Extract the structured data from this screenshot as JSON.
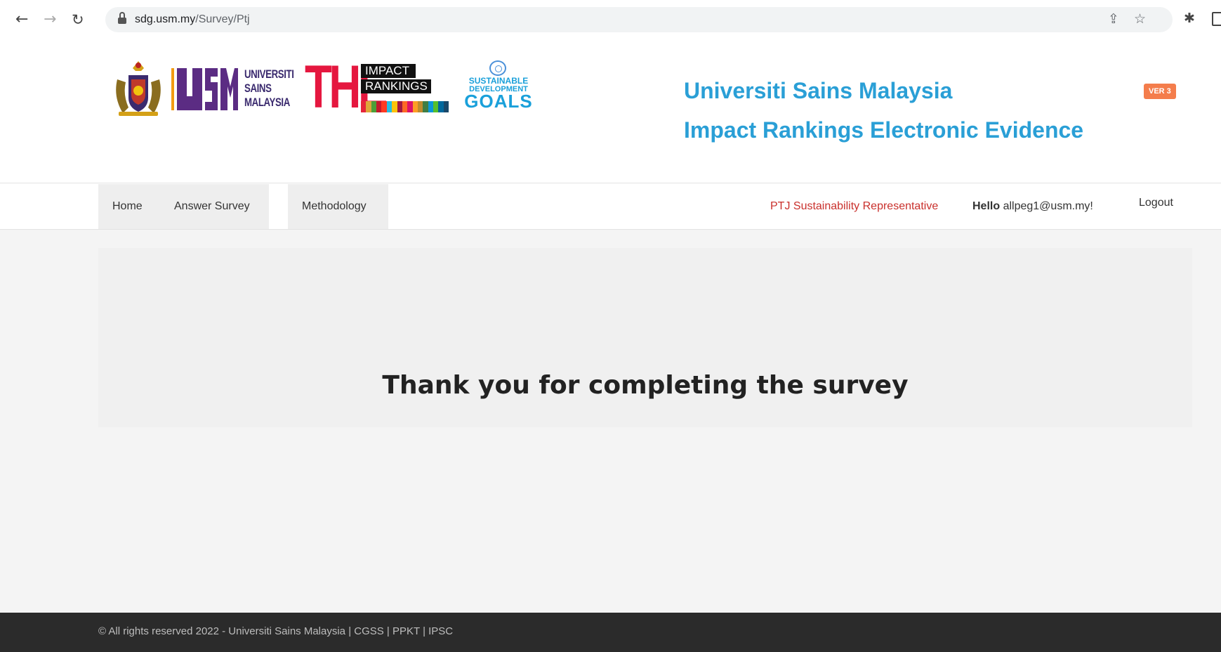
{
  "browser": {
    "url_host": "sdg.usm.my",
    "url_path": "/Survey/Ptj",
    "back_glyph": "←",
    "forward_glyph": "→",
    "reload_glyph": "↻",
    "share_glyph": "⇪",
    "star_glyph": "☆",
    "extension_glyph": "✱"
  },
  "header": {
    "usm_logo_text": [
      "UNIVERSITI",
      "SAINS",
      "MALAYSIA"
    ],
    "the_logo_text": "THE",
    "the_box1": "IMPACT",
    "the_box2": "RANKINGS",
    "sdg_logo_text": [
      "SUSTAINABLE",
      "DEVELOPMENT",
      "GOALS"
    ],
    "title": "Universiti Sains Malaysia",
    "subtitle": "Impact Rankings Electronic Evidence",
    "version_badge": "VER 3"
  },
  "colors": {
    "title_blue": "#2a9fd6",
    "badge_orange": "#f47d4c",
    "role_red": "#c9302c",
    "footer_bg": "#2b2b2b"
  },
  "nav": {
    "home": "Home",
    "answer_survey": "Answer Survey",
    "methodology": "Methodology",
    "role": "PTJ Sustainability Representative",
    "hello_label": "Hello",
    "user_email": "allpeg1@usm.my!",
    "logout": "Logout"
  },
  "main": {
    "message": "Thank you for completing the survey"
  },
  "footer": {
    "text": "© All rights reserved 2022 - Universiti Sains Malaysia | CGSS | PPKT | IPSC"
  }
}
